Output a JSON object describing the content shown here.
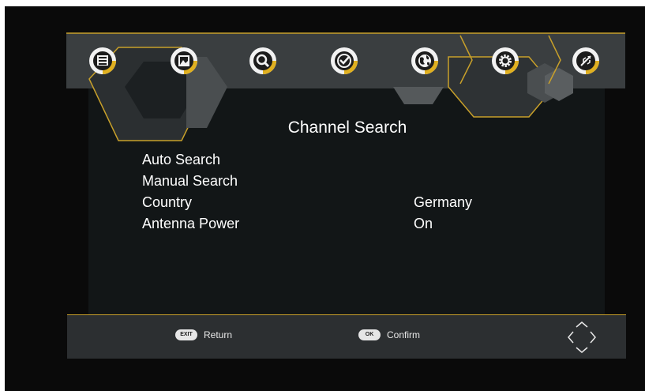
{
  "menu_bar": {
    "icons": [
      {
        "name": "picture-menu-icon"
      },
      {
        "name": "image-menu-icon"
      },
      {
        "name": "channel-search-menu-icon"
      },
      {
        "name": "time-menu-icon"
      },
      {
        "name": "language-menu-icon"
      },
      {
        "name": "settings-menu-icon"
      },
      {
        "name": "usb-menu-icon"
      }
    ],
    "accent_color": "#c8a02a"
  },
  "page": {
    "title": "Channel Search"
  },
  "items": [
    {
      "label": "Auto Search",
      "value": ""
    },
    {
      "label": "Manual Search",
      "value": ""
    },
    {
      "label": "Country",
      "value": "Germany"
    },
    {
      "label": "Antenna Power",
      "value": "On"
    }
  ],
  "footer": {
    "exit_key": "EXIT",
    "return_label": "Return",
    "ok_key": "OK",
    "confirm_label": "Confirm"
  }
}
